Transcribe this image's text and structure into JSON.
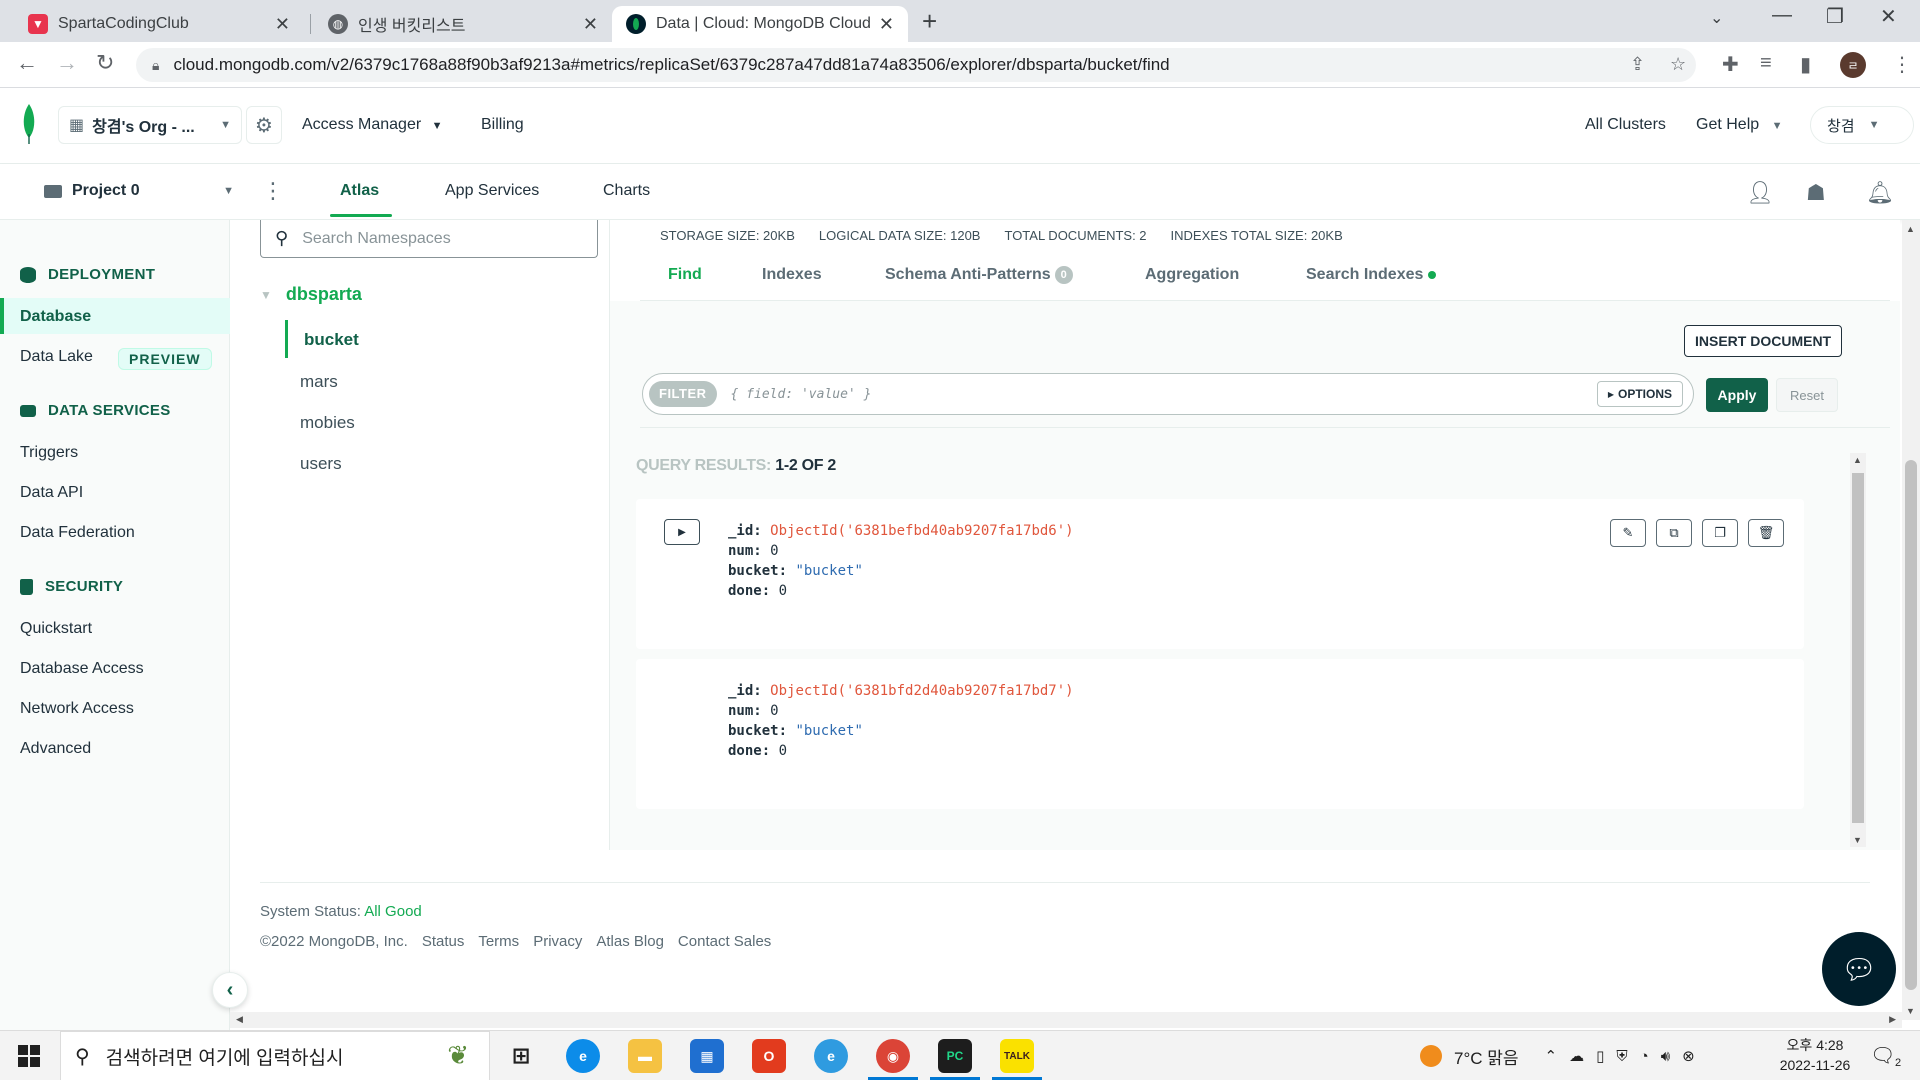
{
  "browser": {
    "tabs": [
      {
        "title": "SpartaCodingClub",
        "favicon": "sparta-icon",
        "color": "#e8344e"
      },
      {
        "title": "인생 버킷리스트",
        "favicon": "globe-icon",
        "color": "#5f6368"
      },
      {
        "title": "Data | Cloud: MongoDB Cloud",
        "favicon": "mongodb-leaf-icon",
        "color": "#13aa52"
      }
    ],
    "url": "cloud.mongodb.com/v2/6379c1768a88f90b3af9213a#metrics/replicaSet/6379c287a47dd81a74a83506/explorer/dbsparta/bucket/find",
    "profile_initial": "ㄹ"
  },
  "header": {
    "org_name": "창겸's Org - ...",
    "access_manager": "Access Manager",
    "billing": "Billing",
    "all_clusters": "All Clusters",
    "get_help": "Get Help",
    "user": "창겸"
  },
  "project_nav": {
    "project": "Project 0",
    "tabs": [
      "Atlas",
      "App Services",
      "Charts"
    ]
  },
  "sidebar": {
    "deployment": "DEPLOYMENT",
    "database": "Database",
    "data_lake": "Data Lake",
    "preview": "PREVIEW",
    "data_services": "DATA SERVICES",
    "triggers": "Triggers",
    "data_api": "Data API",
    "data_federation": "Data Federation",
    "security": "SECURITY",
    "quickstart": "Quickstart",
    "database_access": "Database Access",
    "network_access": "Network Access",
    "advanced": "Advanced"
  },
  "namespaces": {
    "search_placeholder": "Search Namespaces",
    "database": "dbsparta",
    "collections": [
      "bucket",
      "mars",
      "mobies",
      "users"
    ]
  },
  "stats": {
    "storage": "STORAGE SIZE: 20KB",
    "logical": "LOGICAL DATA SIZE: 120B",
    "documents": "TOTAL DOCUMENTS: 2",
    "indexes": "INDEXES TOTAL SIZE: 20KB"
  },
  "subtabs": {
    "find": "Find",
    "indexes": "Indexes",
    "schema": "Schema Anti-Patterns",
    "schema_count": "0",
    "aggregation": "Aggregation",
    "search_indexes": "Search Indexes"
  },
  "toolbar": {
    "insert_document": "INSERT DOCUMENT",
    "filter_tag": "FILTER",
    "filter_placeholder": "{ field: 'value' }",
    "options": "OPTIONS",
    "apply": "Apply",
    "reset": "Reset"
  },
  "results": {
    "label": "QUERY RESULTS:",
    "range": "1-2 OF 2",
    "documents": [
      {
        "id": "ObjectId('6381befbd40ab9207fa17bd6')",
        "num": "0",
        "bucket": "\"bucket\"",
        "done": "0"
      },
      {
        "id": "ObjectId('6381bfd2d40ab9207fa17bd7')",
        "num": "0",
        "bucket": "\"bucket\"",
        "done": "0"
      }
    ]
  },
  "footer": {
    "status_label": "System Status:",
    "status_value": "All Good",
    "links": [
      "©2022 MongoDB, Inc.",
      "Status",
      "Terms",
      "Privacy",
      "Atlas Blog",
      "Contact Sales"
    ]
  },
  "taskbar": {
    "search_placeholder": "검색하려면 여기에 입력하십시",
    "weather": "7°C 맑음",
    "time": "오후 4:28",
    "date": "2022-11-26",
    "notifications": "2"
  }
}
